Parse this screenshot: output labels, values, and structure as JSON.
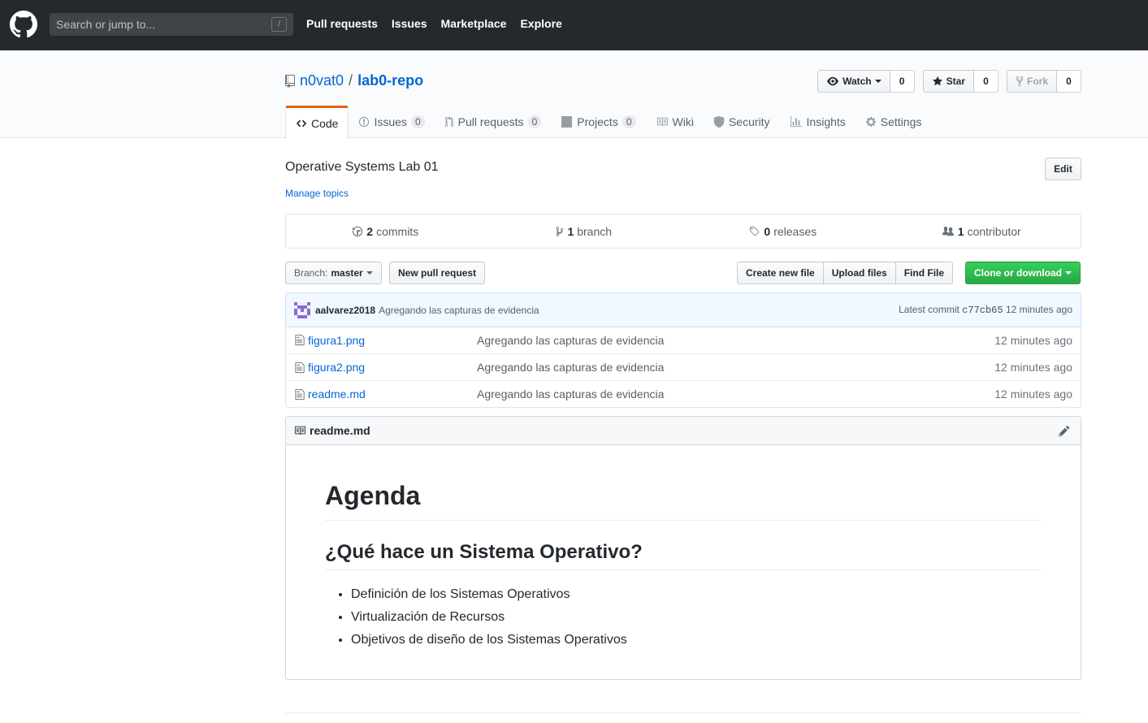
{
  "header": {
    "search_placeholder": "Search or jump to...",
    "search_shortcut": "/",
    "nav": [
      "Pull requests",
      "Issues",
      "Marketplace",
      "Explore"
    ]
  },
  "repo": {
    "owner": "n0vat0",
    "separator": "/",
    "name": "lab0-repo",
    "watch": {
      "label": "Watch",
      "count": "0"
    },
    "star": {
      "label": "Star",
      "count": "0"
    },
    "fork": {
      "label": "Fork",
      "count": "0"
    }
  },
  "tabs": [
    {
      "label": "Code",
      "icon": "code-icon"
    },
    {
      "label": "Issues",
      "counter": "0",
      "icon": "issue-icon"
    },
    {
      "label": "Pull requests",
      "counter": "0",
      "icon": "pull-request-icon"
    },
    {
      "label": "Projects",
      "counter": "0",
      "icon": "project-icon"
    },
    {
      "label": "Wiki",
      "icon": "wiki-icon"
    },
    {
      "label": "Security",
      "icon": "shield-icon"
    },
    {
      "label": "Insights",
      "icon": "graph-icon"
    },
    {
      "label": "Settings",
      "icon": "gear-icon"
    }
  ],
  "description": "Operative Systems Lab 01",
  "manage_topics": "Manage topics",
  "edit_label": "Edit",
  "numbers": {
    "commits": {
      "count": "2",
      "label": "commits"
    },
    "branches": {
      "count": "1",
      "label": "branch"
    },
    "releases": {
      "count": "0",
      "label": "releases"
    },
    "contributors": {
      "count": "1",
      "label": "contributor"
    }
  },
  "file_nav": {
    "branch_prefix": "Branch:",
    "branch": "master",
    "new_pull_request": "New pull request",
    "create_new_file": "Create new file",
    "upload_files": "Upload files",
    "find_file": "Find File",
    "clone": "Clone or download"
  },
  "commit": {
    "author": "aalvarez2018",
    "message": "Agregando las capturas de evidencia",
    "latest_label": "Latest commit",
    "sha": "c77cb65",
    "age": "12 minutes ago"
  },
  "files": [
    {
      "name": "figura1.png",
      "message": "Agregando las capturas de evidencia",
      "age": "12 minutes ago"
    },
    {
      "name": "figura2.png",
      "message": "Agregando las capturas de evidencia",
      "age": "12 minutes ago"
    },
    {
      "name": "readme.md",
      "message": "Agregando las capturas de evidencia",
      "age": "12 minutes ago"
    }
  ],
  "readme": {
    "filename": "readme.md",
    "h1": "Agenda",
    "h2": "¿Qué hace un Sistema Operativo?",
    "items": [
      "Definición de los Sistemas Operativos",
      "Virtualización de Recursos",
      "Objetivos de diseño de los Sistemas Operativos"
    ]
  },
  "colors": {
    "header_bg": "#24292e",
    "link": "#0366d6",
    "tab_accent": "#e36209",
    "clone_green": "#28a745"
  }
}
